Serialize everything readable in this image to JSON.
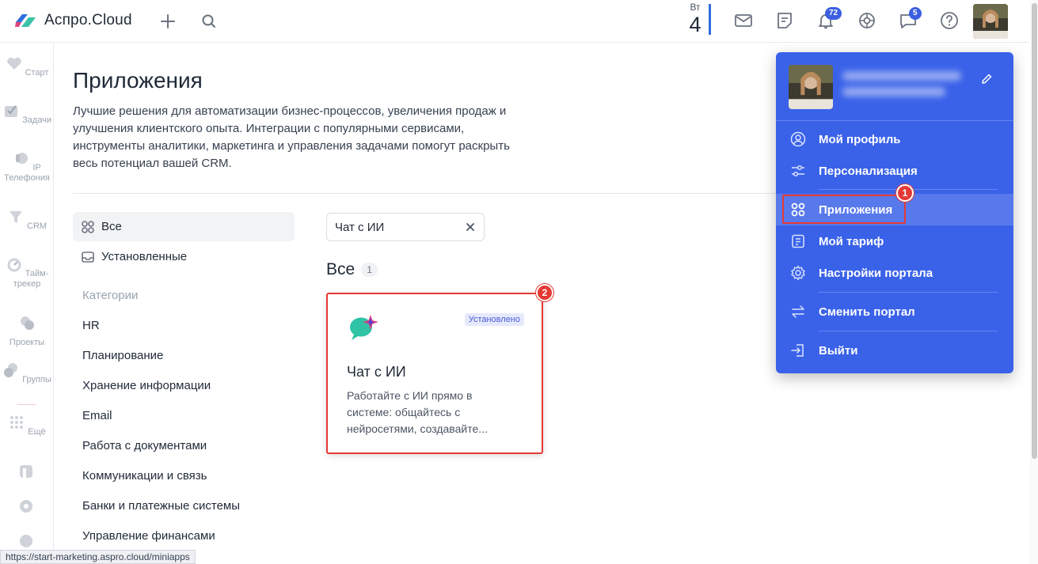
{
  "header": {
    "brand": "Аспро.Cloud",
    "date_dow": "Вт",
    "date_day": "4",
    "notifications_count": "72",
    "messages_count": "5",
    "accent": "#3a62e9"
  },
  "rail": {
    "items": [
      {
        "label": "Старт",
        "icon": "heart-icon"
      },
      {
        "label": "Задачи",
        "icon": "tasks-icon"
      },
      {
        "label": "IP\nТелефония",
        "icon": "phone-icon"
      },
      {
        "label": "CRM",
        "icon": "crm-icon"
      },
      {
        "label": "Тайм-\nтрекер",
        "icon": "timer-icon"
      },
      {
        "label": "Проекты",
        "icon": "projects-icon"
      },
      {
        "label": "Группы",
        "icon": "groups-icon"
      },
      {
        "label": "Ещё",
        "icon": "grid-dots-icon"
      }
    ]
  },
  "main": {
    "title": "Приложения",
    "description": "Лучшие решения для автоматизации бизнес-процессов, увеличения продаж и улучшения клиентского опыта. Интеграции с популярными сервисами, инструменты аналитики, маркетинга и управления задачами помогут раскрыть весь потенциал вашей CRM.",
    "filters": {
      "all": "Все",
      "installed": "Установленные"
    },
    "categories_heading": "Категории",
    "categories": [
      "HR",
      "Планирование",
      "Хранение информации",
      "Email",
      "Работа с документами",
      "Коммуникации и связь",
      "Банки и платежные системы",
      "Управление финансами"
    ],
    "search_value": "Чат с ИИ",
    "section_title": "Все",
    "section_count": "1",
    "app": {
      "name": "Чат с ИИ",
      "badge": "Установлено",
      "description": "Работайте с ИИ прямо в системе: общайтесь с нейросетями, создавайте..."
    }
  },
  "menu": {
    "items": [
      {
        "label": "Мой профиль",
        "icon": "profile-icon"
      },
      {
        "label": "Персонализация",
        "icon": "sliders-icon"
      },
      {
        "label": "Приложения",
        "icon": "apps-icon"
      },
      {
        "label": "Мой тариф",
        "icon": "tariff-icon"
      },
      {
        "label": "Настройки портала",
        "icon": "gear-icon"
      },
      {
        "label": "Сменить портал",
        "icon": "swap-icon"
      },
      {
        "label": "Выйти",
        "icon": "logout-icon"
      }
    ]
  },
  "annotations": {
    "step1": "1",
    "step2": "2"
  },
  "status_bar": {
    "url": "https://start-marketing.aspro.cloud/miniapps"
  }
}
